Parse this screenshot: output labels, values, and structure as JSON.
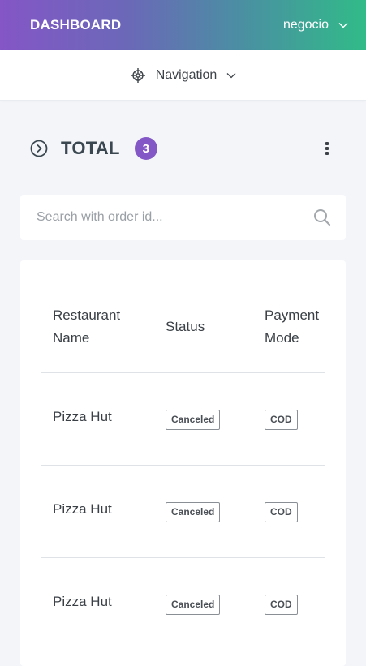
{
  "header": {
    "brand": "DASHBOARD",
    "user": "negocio",
    "gradient_start": "#8456c6",
    "gradient_end": "#31bb88"
  },
  "navbar": {
    "label": "Navigation",
    "icon": "compass-icon"
  },
  "summary": {
    "title": "TOTAL",
    "count": "3",
    "badge_color": "#8457c6"
  },
  "search": {
    "placeholder": "Search with order id...",
    "value": ""
  },
  "table": {
    "columns": [
      "Restaurant Name",
      "Status",
      "Payment Mode"
    ],
    "rows": [
      {
        "restaurant": "Pizza Hut",
        "status": "Canceled",
        "payment": "COD"
      },
      {
        "restaurant": "Pizza Hut",
        "status": "Canceled",
        "payment": "COD"
      },
      {
        "restaurant": "Pizza Hut",
        "status": "Canceled",
        "payment": "COD"
      }
    ]
  }
}
